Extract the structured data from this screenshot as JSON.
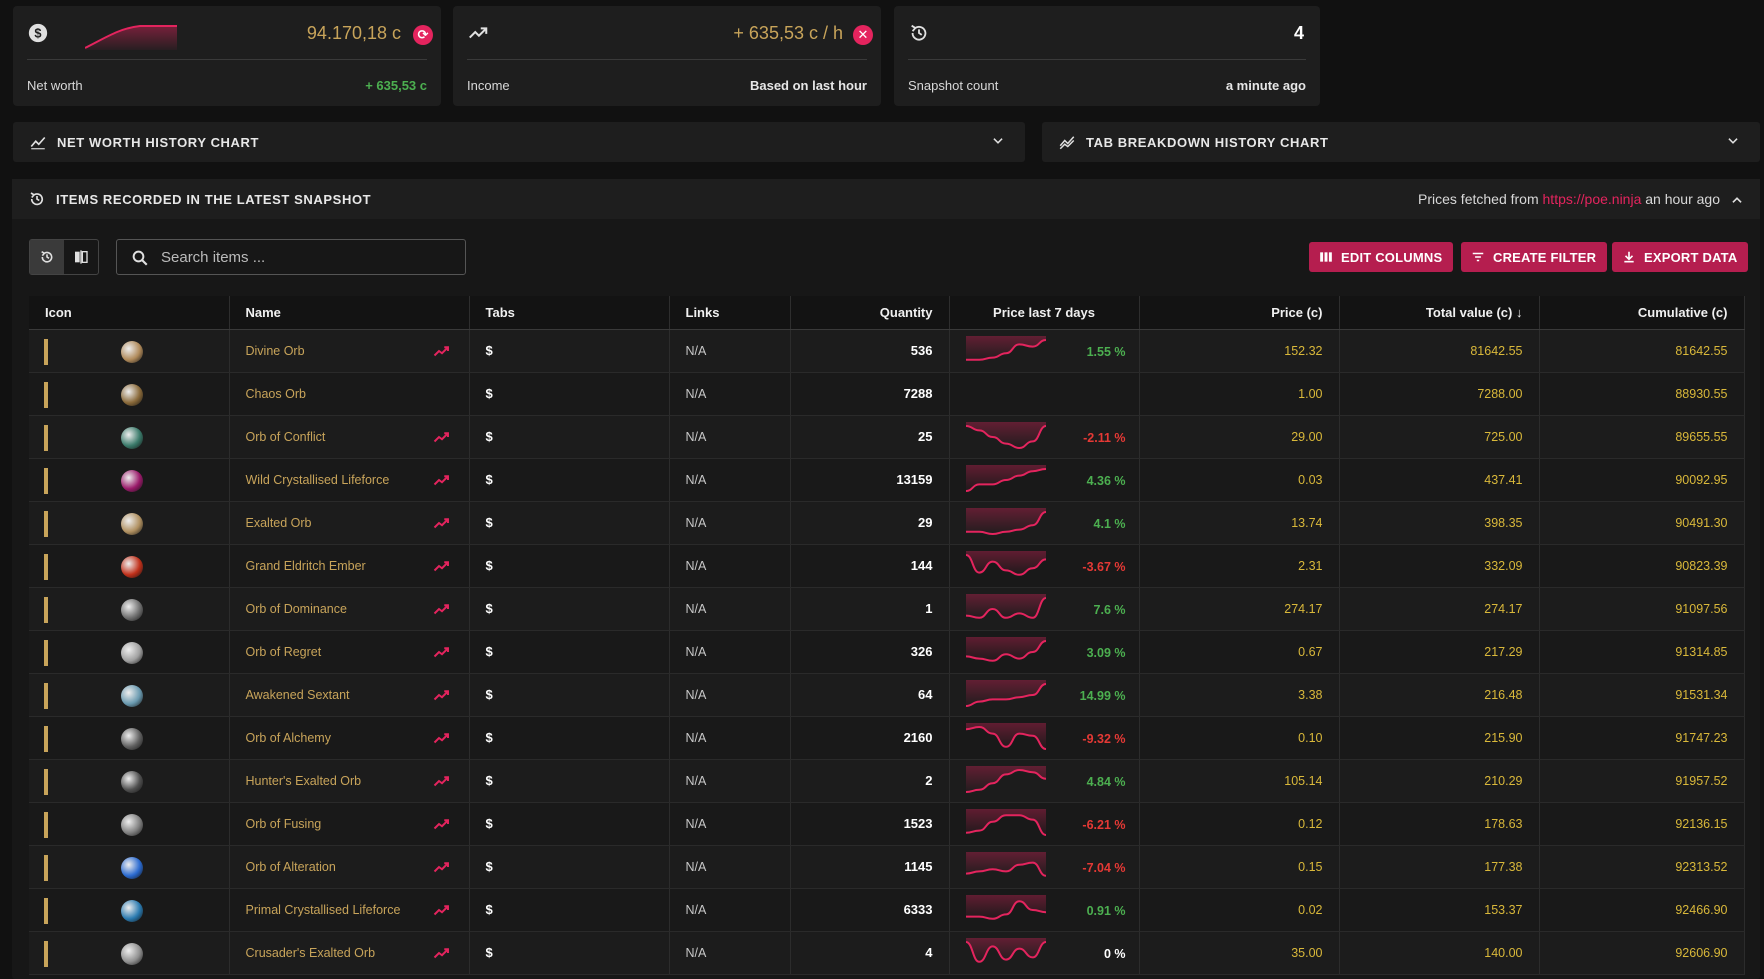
{
  "cards": {
    "net_worth": {
      "value": "94.170,18 c",
      "label": "Net worth",
      "change": "+ 635,53 c"
    },
    "income": {
      "value": "+ 635,53 c / h",
      "label": "Income",
      "note": "Based on last hour"
    },
    "snapshots": {
      "value": "4",
      "label": "Snapshot count",
      "note": "a minute ago"
    }
  },
  "panels": {
    "net_worth_chart": "NET WORTH HISTORY CHART",
    "tab_breakdown_chart": "TAB BREAKDOWN HISTORY CHART",
    "items_section": "ITEMS RECORDED IN THE LATEST SNAPSHOT"
  },
  "prices": {
    "prefix": "Prices fetched from",
    "link": "https://poe.ninja",
    "suffix": "an hour ago"
  },
  "search": {
    "placeholder": "Search items ..."
  },
  "buttons": {
    "edit_columns": "EDIT COLUMNS",
    "create_filter": "CREATE FILTER",
    "export_data": "EXPORT DATA"
  },
  "columns": [
    "Icon",
    "Name",
    "Tabs",
    "Links",
    "Quantity",
    "Price last 7 days",
    "Price (c)",
    "Total value (c)",
    "Cumulative (c)"
  ],
  "colors": {
    "accent": "#e4245e",
    "button": "#b51e4f",
    "gold": "#c8a45a",
    "value": "#d9b83a",
    "positive": "#4caf50",
    "negative": "#e53935"
  },
  "rows": [
    {
      "name": "Divine Orb",
      "tabs": "$",
      "links": "N/A",
      "quantity": "536",
      "pct": "1.55 %",
      "trend": "pos",
      "spark": [
        9,
        9,
        8,
        6,
        2,
        3,
        0
      ],
      "price": "152.32",
      "total": "81642.55",
      "cumulative": "81642.55",
      "orb": "#b08a5a"
    },
    {
      "name": "Chaos Orb",
      "tabs": "$",
      "links": "N/A",
      "quantity": "7288",
      "pct": "",
      "trend": "none",
      "spark": [],
      "price": "1.00",
      "total": "7288.00",
      "cumulative": "88930.55",
      "orb": "#8a6a3a"
    },
    {
      "name": "Orb of Conflict",
      "tabs": "$",
      "links": "N/A",
      "quantity": "25",
      "pct": "-2.11 %",
      "trend": "neg",
      "spark": [
        0,
        2,
        5,
        8,
        10,
        7,
        0
      ],
      "price": "29.00",
      "total": "725.00",
      "cumulative": "89655.55",
      "orb": "#3a7a6a"
    },
    {
      "name": "Wild Crystallised Lifeforce",
      "tabs": "$",
      "links": "N/A",
      "quantity": "13159",
      "pct": "4.36 %",
      "trend": "pos",
      "spark": [
        10,
        7,
        7,
        5,
        3,
        1,
        0
      ],
      "price": "0.03",
      "total": "437.41",
      "cumulative": "90092.95",
      "orb": "#9a1a6a"
    },
    {
      "name": "Exalted Orb",
      "tabs": "$",
      "links": "N/A",
      "quantity": "29",
      "pct": "4.1 %",
      "trend": "pos",
      "spark": [
        9,
        9,
        10,
        9,
        8,
        6,
        0
      ],
      "price": "13.74",
      "total": "398.35",
      "cumulative": "90491.30",
      "orb": "#b09060"
    },
    {
      "name": "Grand Eldritch Ember",
      "tabs": "$",
      "links": "N/A",
      "quantity": "144",
      "pct": "-3.67 %",
      "trend": "neg",
      "spark": [
        0,
        8,
        3,
        7,
        9,
        6,
        2
      ],
      "price": "2.31",
      "total": "332.09",
      "cumulative": "90823.39",
      "orb": "#c0301a"
    },
    {
      "name": "Orb of Dominance",
      "tabs": "$",
      "links": "N/A",
      "quantity": "1",
      "pct": "7.6 %",
      "trend": "pos",
      "spark": [
        8,
        9,
        5,
        9,
        7,
        9,
        0
      ],
      "price": "274.17",
      "total": "274.17",
      "cumulative": "91097.56",
      "orb": "#707070"
    },
    {
      "name": "Orb of Regret",
      "tabs": "$",
      "links": "N/A",
      "quantity": "326",
      "pct": "3.09 %",
      "trend": "pos",
      "spark": [
        7,
        8,
        9,
        6,
        8,
        5,
        0
      ],
      "price": "0.67",
      "total": "217.29",
      "cumulative": "91314.85",
      "orb": "#a0a0a0"
    },
    {
      "name": "Awakened Sextant",
      "tabs": "$",
      "links": "N/A",
      "quantity": "64",
      "pct": "14.99 %",
      "trend": "pos",
      "spark": [
        10,
        8,
        7,
        7,
        6,
        5,
        0
      ],
      "price": "3.38",
      "total": "216.48",
      "cumulative": "91531.34",
      "orb": "#6a9ab0"
    },
    {
      "name": "Orb of Alchemy",
      "tabs": "$",
      "links": "N/A",
      "quantity": "2160",
      "pct": "-9.32 %",
      "trend": "neg",
      "spark": [
        1,
        0,
        3,
        9,
        3,
        4,
        10
      ],
      "price": "0.10",
      "total": "215.90",
      "cumulative": "91747.23",
      "orb": "#606060"
    },
    {
      "name": "Hunter's Exalted Orb",
      "tabs": "$",
      "links": "N/A",
      "quantity": "2",
      "pct": "4.84 %",
      "trend": "pos",
      "spark": [
        10,
        9,
        6,
        2,
        0,
        1,
        4
      ],
      "price": "105.14",
      "total": "210.29",
      "cumulative": "91957.52",
      "orb": "#505050"
    },
    {
      "name": "Orb of Fusing",
      "tabs": "$",
      "links": "N/A",
      "quantity": "1523",
      "pct": "-6.21 %",
      "trend": "neg",
      "spark": [
        9,
        8,
        4,
        1,
        1,
        3,
        10
      ],
      "price": "0.12",
      "total": "178.63",
      "cumulative": "92136.15",
      "orb": "#808080"
    },
    {
      "name": "Orb of Alteration",
      "tabs": "$",
      "links": "N/A",
      "quantity": "1145",
      "pct": "-7.04 %",
      "trend": "neg",
      "spark": [
        8,
        7,
        6,
        7,
        4,
        3,
        9
      ],
      "price": "0.15",
      "total": "177.38",
      "cumulative": "92313.52",
      "orb": "#2a6ad0"
    },
    {
      "name": "Primal Crystallised Lifeforce",
      "tabs": "$",
      "links": "N/A",
      "quantity": "6333",
      "pct": "0.91 %",
      "trend": "pos",
      "spark": [
        8,
        8,
        9,
        7,
        1,
        5,
        6
      ],
      "price": "0.02",
      "total": "153.37",
      "cumulative": "92466.90",
      "orb": "#2a7ab0"
    },
    {
      "name": "Crusader's Exalted Orb",
      "tabs": "$",
      "links": "N/A",
      "quantity": "4",
      "pct": "0 %",
      "trend": "zero",
      "spark": [
        0,
        9,
        2,
        8,
        3,
        7,
        0
      ],
      "price": "35.00",
      "total": "140.00",
      "cumulative": "92606.90",
      "orb": "#909090"
    }
  ]
}
